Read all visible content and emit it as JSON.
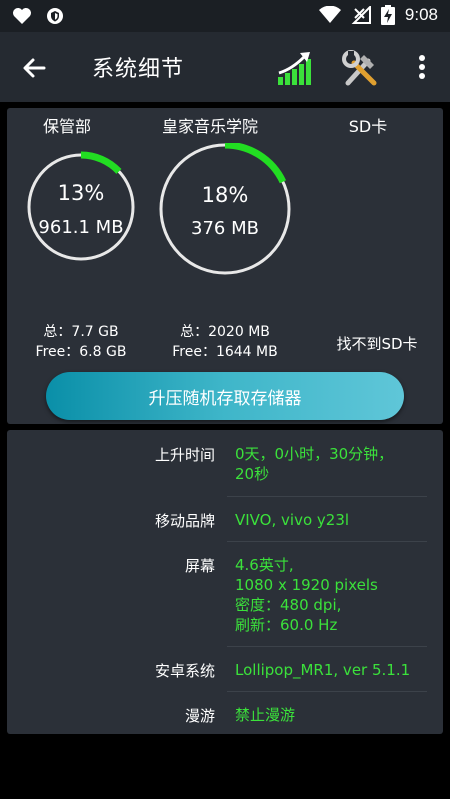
{
  "status_bar": {
    "time": "9:08"
  },
  "app_bar": {
    "title": "系统细节"
  },
  "storage": {
    "columns": [
      {
        "name": "保管部",
        "percent": "13%",
        "used": "961.1 MB",
        "fraction": 0.13,
        "total": "总：7.7 GB",
        "free": "Free：6.8 GB"
      },
      {
        "name": "皇家音乐学院",
        "percent": "18%",
        "used": "376 MB",
        "fraction": 0.18,
        "total": "总：2020 MB",
        "free": "Free：1644 MB"
      },
      {
        "name": "SD卡",
        "message": "找不到SD卡"
      }
    ],
    "button_label": "升压随机存取存储器",
    "colors": {
      "ring_track": "#e8e8e8",
      "ring_fill": "#22dd22",
      "value_text": "#3be13b"
    }
  },
  "details": [
    {
      "label": "上升时间",
      "value": [
        "0天，0小时，30分钟，",
        "20秒"
      ]
    },
    {
      "label": "移动品牌",
      "value": [
        "VIVO, vivo y23l"
      ]
    },
    {
      "label": "屏幕",
      "value": [
        "4.6英寸,",
        "1080 x 1920 pixels",
        "密度：480 dpi,",
        "刷新：60.0 Hz"
      ]
    },
    {
      "label": "安卓系统",
      "value": [
        "Lollipop_MR1, ver 5.1.1"
      ]
    },
    {
      "label": "漫游",
      "value": [
        "禁止漫游"
      ]
    }
  ]
}
